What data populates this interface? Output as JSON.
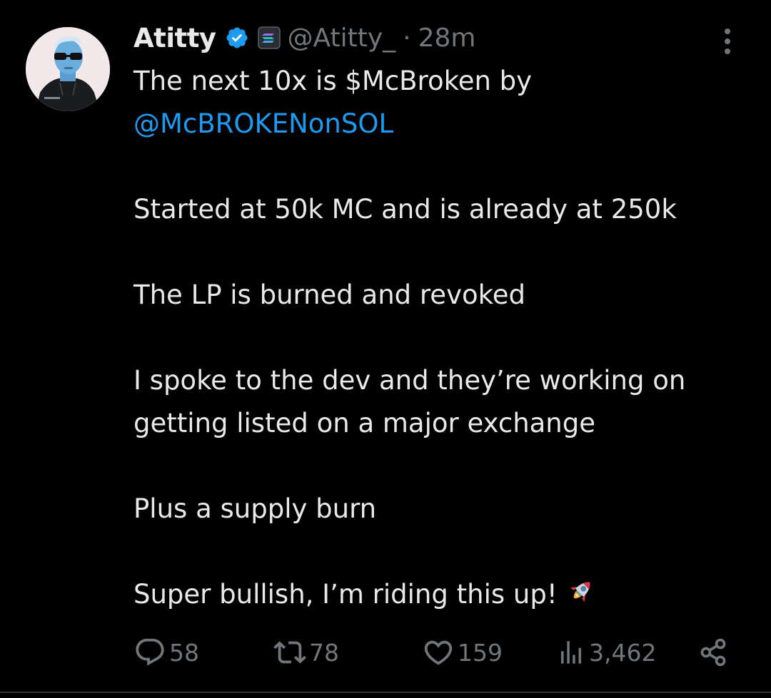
{
  "author": {
    "display_name": "Atitty",
    "handle": "@Atitty_",
    "separator": "·",
    "timestamp": "28m",
    "avatar_icon": "avatar-image",
    "verified_icon": "verified-badge-icon",
    "affiliate_icon": "solana-affiliate-icon"
  },
  "tweet": {
    "line1": "The next 10x is $McBroken by",
    "mention": "@McBROKENonSOL",
    "para2": "Started at 50k MC and is already at 250k",
    "para3": "The LP is burned and revoked",
    "para4_line1": "I spoke to the dev and they’re working on",
    "para4_line2": "getting listed on a major exchange",
    "para5": "Plus a supply burn",
    "para6": "Super bullish, I’m riding this up!",
    "emoji": "rocket"
  },
  "actions": {
    "replies": "58",
    "reposts": "78",
    "likes": "159",
    "views": "3,462"
  },
  "colors": {
    "background": "#000000",
    "text": "#e7e9ea",
    "muted": "#71767b",
    "link": "#1d9bf0",
    "verified": "#1d9bf0"
  }
}
